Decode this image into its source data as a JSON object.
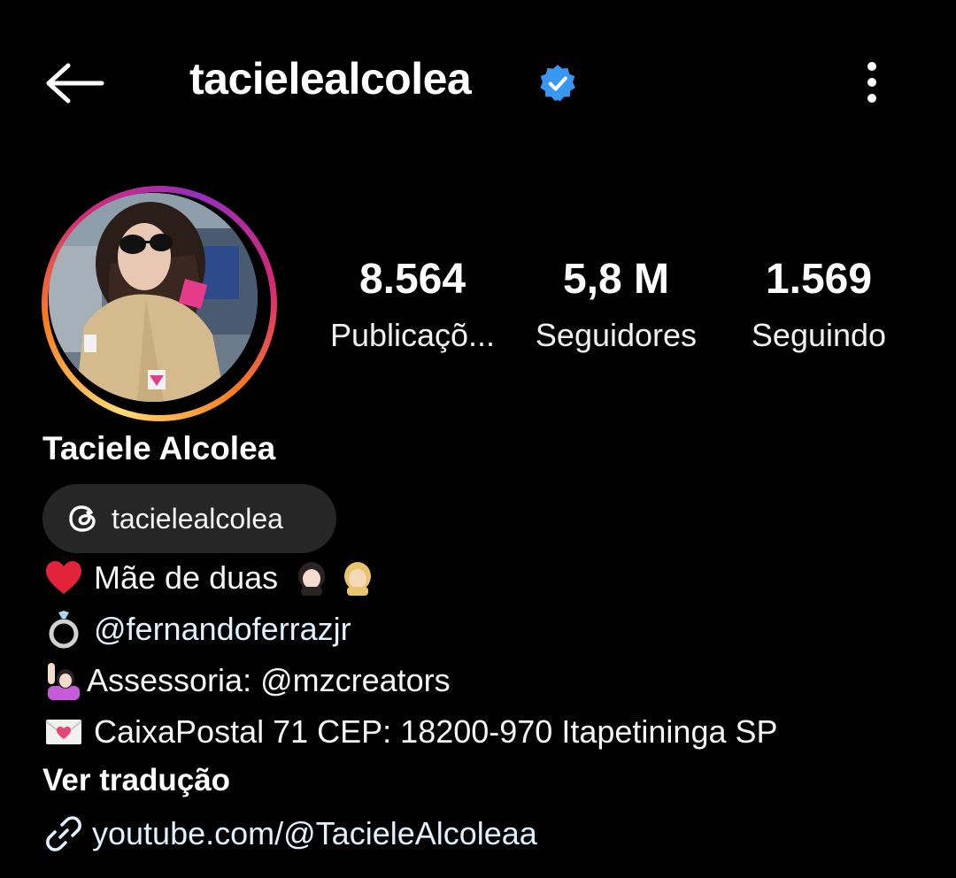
{
  "header": {
    "username": "tacielealcolea",
    "verified_color": "#3897f0"
  },
  "stats": [
    {
      "value": "8.564",
      "label": "Publicaçõ..."
    },
    {
      "value": "5,8 M",
      "label": "Seguidores"
    },
    {
      "value": "1.569",
      "label": "Seguindo"
    }
  ],
  "profile": {
    "display_name": "Taciele Alcolea",
    "threads_handle": "tacielealcolea",
    "bio": [
      {
        "icon": "heart-icon",
        "text": "Mãe de duas"
      },
      {
        "icon": "ring-icon",
        "text": "@fernandoferrazjr"
      },
      {
        "icon": "person-raising-hand-icon",
        "text": "Assessoria: @mzcreators"
      },
      {
        "icon": "love-letter-icon",
        "text": "CaixaPostal 71 CEP: 18200-970 Itapetininga SP"
      }
    ],
    "see_translation": "Ver tradução",
    "link": "youtube.com/@TacieleAlcoleaa"
  },
  "colors": {
    "background": "#000000",
    "chip_background": "#262626",
    "link": "#e0f1ff"
  }
}
